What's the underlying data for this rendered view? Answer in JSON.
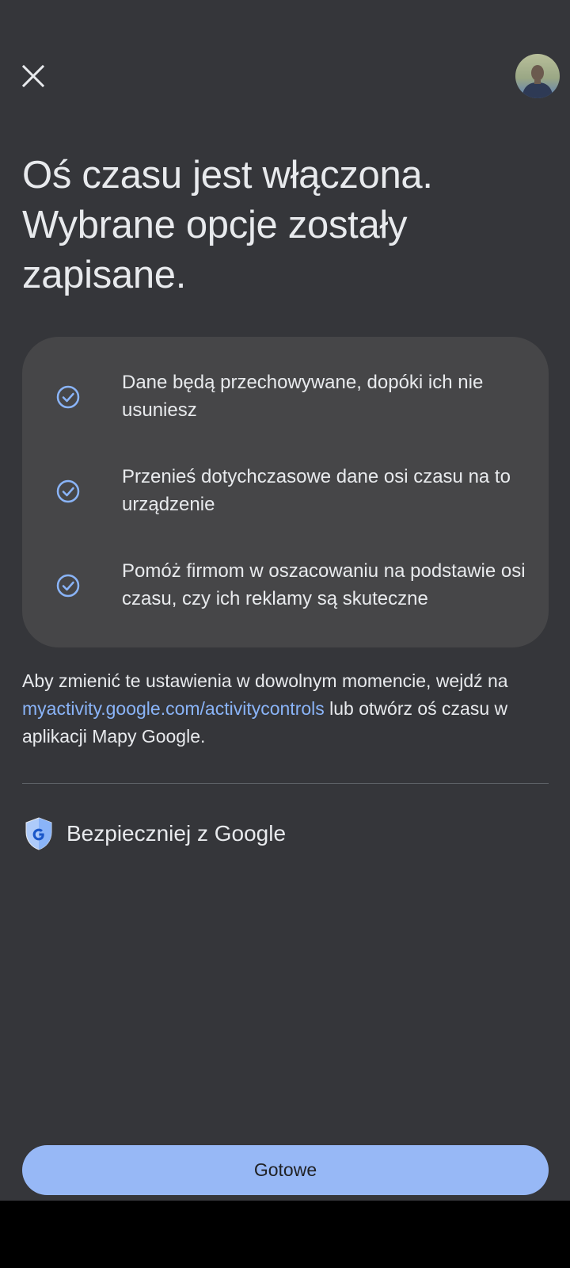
{
  "header": {
    "close_icon": "close-icon",
    "avatar_icon": "account-avatar"
  },
  "headline": {
    "line1": "Oś czasu jest włączona.",
    "line2": "Wybrane opcje zostały",
    "line3": "zapisane."
  },
  "card": {
    "items": [
      {
        "label": "Dane będą przechowywane, dopóki ich nie usuniesz",
        "icon": "check-circle-icon"
      },
      {
        "label": "Przenieś dotychczasowe dane osi czasu na to urządzenie",
        "icon": "check-circle-icon"
      },
      {
        "label": "Pomóż firmom w oszacowaniu na podstawie osi czasu, czy ich reklamy są skuteczne",
        "icon": "check-circle-icon"
      }
    ]
  },
  "info": {
    "prefix": "Aby zmienić te ustawienia w dowolnym momencie, wejdź na ",
    "link": "myactivity.google.com/activitycontrols",
    "suffix": " lub otwórz oś czasu w aplikacji Mapy Google."
  },
  "safer": {
    "label": "Bezpieczniej z Google",
    "icon": "google-shield-icon"
  },
  "footer": {
    "done_label": "Gotowe"
  },
  "colors": {
    "background": "#35363a",
    "card": "#464648",
    "accent": "#8ab4f8",
    "button": "#97b8f6",
    "text": "#e8eaed"
  }
}
